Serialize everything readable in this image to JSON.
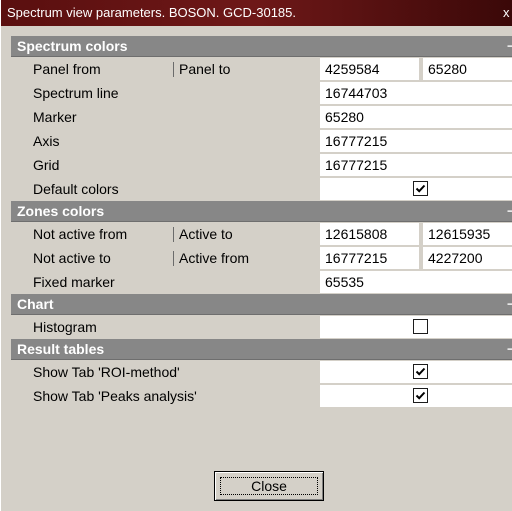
{
  "window": {
    "title": "Spectrum view parameters. BOSON. GCD-30185.",
    "close_glyph": "x"
  },
  "sections": {
    "spectrum_colors": "Spectrum colors",
    "zones_colors": "Zones colors",
    "chart": "Chart",
    "result_tables": "Result tables",
    "collapse_glyph": "−"
  },
  "rows": {
    "panel": {
      "label": "Panel from",
      "label2": "Panel to",
      "value1": "4259584",
      "value2": "65280"
    },
    "spectrum_line": {
      "label": "Spectrum line",
      "value": "16744703"
    },
    "marker": {
      "label": "Marker",
      "value": "65280"
    },
    "axis": {
      "label": "Axis",
      "value": "16777215"
    },
    "grid": {
      "label": "Grid",
      "value": "16777215"
    },
    "default_colors": {
      "label": "Default colors",
      "checked": true
    },
    "not_active_from": {
      "label": "Not active from",
      "label2": "Active to",
      "value1": "12615808",
      "value2": "12615935"
    },
    "not_active_to": {
      "label": "Not active to",
      "label2": "Active from",
      "value1": "16777215",
      "value2": "4227200"
    },
    "fixed_marker": {
      "label": "Fixed marker",
      "value": "65535"
    },
    "histogram": {
      "label": "Histogram",
      "checked": false
    },
    "show_roi": {
      "label": "Show Tab 'ROI-method'",
      "checked": true
    },
    "show_peaks": {
      "label": "Show Tab 'Peaks analysis'",
      "checked": true
    }
  },
  "footer": {
    "close_label": "Close"
  },
  "colors": {
    "title_bar": "#5a0f0f",
    "section_header": "#878787",
    "panel_background": "#d4d0c8",
    "value_background": "#ffffff"
  }
}
